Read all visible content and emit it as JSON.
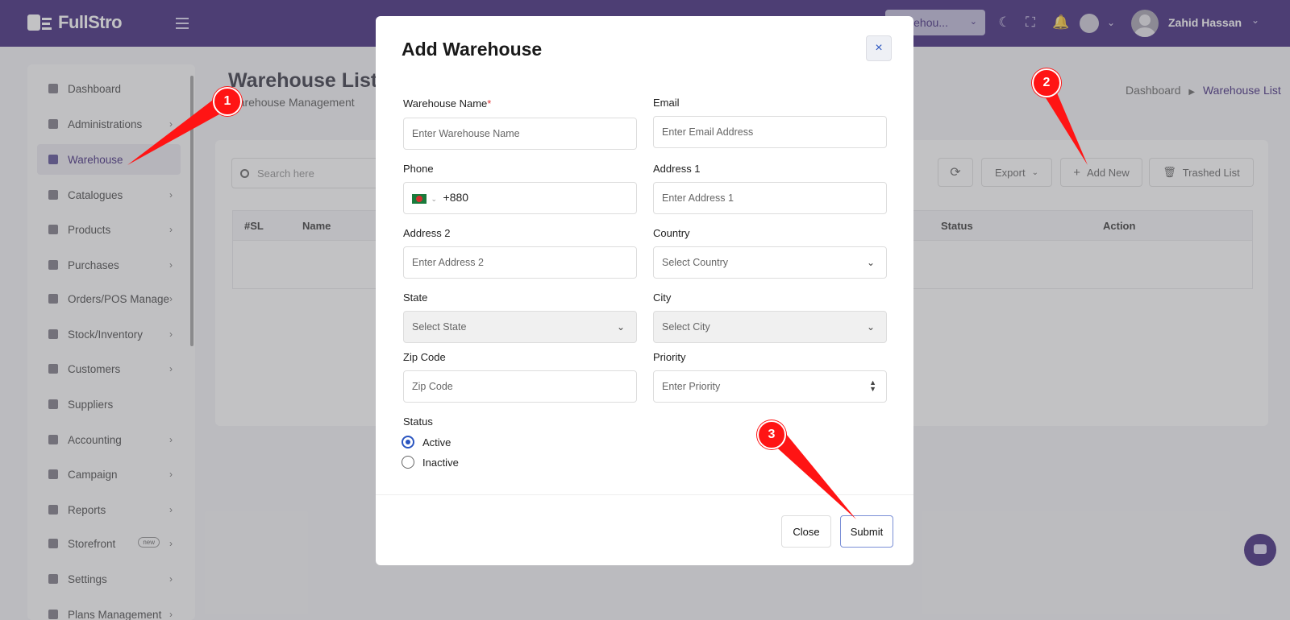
{
  "app": {
    "logo_text": "FullStro",
    "warehouse_selector": "Warehou...",
    "user_name": "Zahid Hassan"
  },
  "sidebar": {
    "items": [
      {
        "label": "Dashboard",
        "icon": "monitor-icon",
        "has_children": false
      },
      {
        "label": "Administrations",
        "icon": "user-gear-icon",
        "has_children": true
      },
      {
        "label": "Warehouse",
        "icon": "warehouse-icon",
        "has_children": false,
        "active": true
      },
      {
        "label": "Catalogues",
        "icon": "book-icon",
        "has_children": true
      },
      {
        "label": "Products",
        "icon": "cart-icon",
        "has_children": true
      },
      {
        "label": "Purchases",
        "icon": "bag-icon",
        "has_children": true
      },
      {
        "label": "Orders/POS Manage",
        "icon": "receipt-icon",
        "has_children": true
      },
      {
        "label": "Stock/Inventory",
        "icon": "box-icon",
        "has_children": true
      },
      {
        "label": "Customers",
        "icon": "users-icon",
        "has_children": true
      },
      {
        "label": "Suppliers",
        "icon": "supplier-icon",
        "has_children": false
      },
      {
        "label": "Accounting",
        "icon": "wallet-icon",
        "has_children": true
      },
      {
        "label": "Campaign",
        "icon": "megaphone-icon",
        "has_children": true
      },
      {
        "label": "Reports",
        "icon": "chart-icon",
        "has_children": true
      },
      {
        "label": "Storefront",
        "icon": "store-icon",
        "has_children": true,
        "badge": "new"
      },
      {
        "label": "Settings",
        "icon": "gear-icon",
        "has_children": true
      },
      {
        "label": "Plans Management",
        "icon": "plan-icon",
        "has_children": true
      }
    ]
  },
  "page": {
    "title": "Warehouse List",
    "subtitle": "Warehouse Management",
    "breadcrumb_home": "Dashboard",
    "breadcrumb_current": "Warehouse List"
  },
  "toolbar": {
    "search_placeholder": "Search here",
    "export_label": "Export",
    "add_new_label": "Add New",
    "trashed_label": "Trashed List"
  },
  "table": {
    "columns": [
      "#SL",
      "Name",
      "Status",
      "Action"
    ]
  },
  "modal": {
    "title": "Add Warehouse",
    "close_x": "×",
    "fields": {
      "warehouse_name": {
        "label": "Warehouse Name",
        "required": "*",
        "placeholder": "Enter Warehouse Name"
      },
      "email": {
        "label": "Email",
        "placeholder": "Enter Email Address"
      },
      "phone": {
        "label": "Phone",
        "value": "+880"
      },
      "address1": {
        "label": "Address 1",
        "placeholder": "Enter Address 1"
      },
      "address2": {
        "label": "Address 2",
        "placeholder": "Enter Address 2"
      },
      "country": {
        "label": "Country",
        "placeholder": "Select Country"
      },
      "state": {
        "label": "State",
        "placeholder": "Select State"
      },
      "city": {
        "label": "City",
        "placeholder": "Select City"
      },
      "zip": {
        "label": "Zip Code",
        "placeholder": "Zip Code"
      },
      "priority": {
        "label": "Priority",
        "placeholder": "Enter Priority"
      }
    },
    "status": {
      "label": "Status",
      "options": [
        "Active",
        "Inactive"
      ],
      "selected": "Active"
    },
    "close_button": "Close",
    "submit_button": "Submit"
  },
  "annotations": {
    "markers": [
      "1",
      "2",
      "3"
    ],
    "color": "#ff1414"
  },
  "colors": {
    "brand": "#2a0f6e",
    "accent": "#2a55c0"
  }
}
